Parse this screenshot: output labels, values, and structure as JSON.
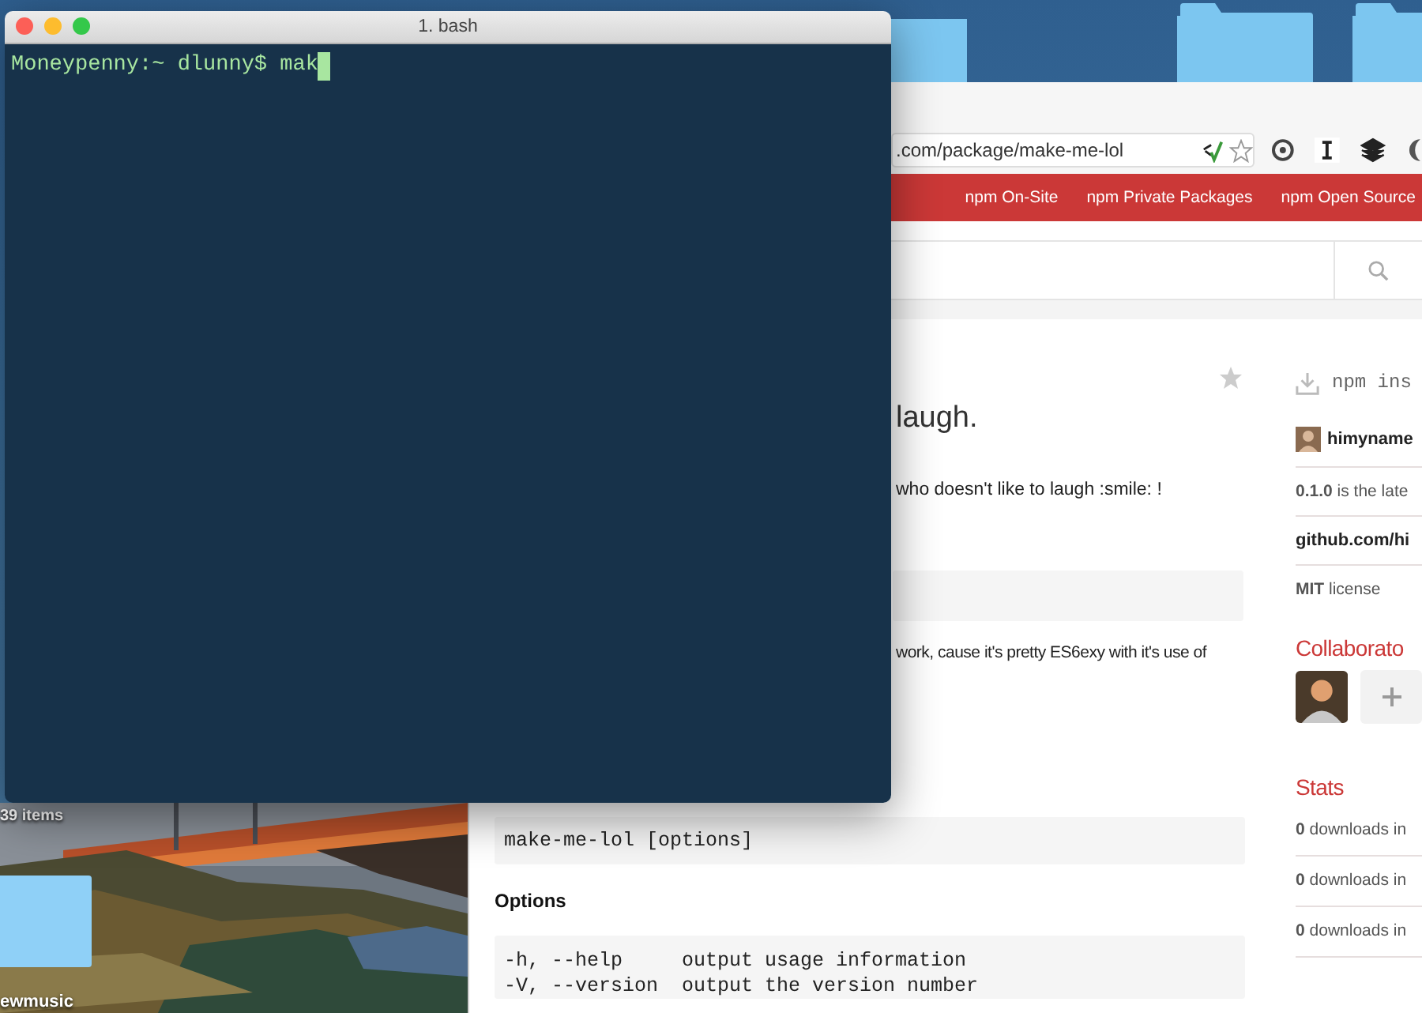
{
  "desktop": {
    "labels": [
      {
        "kind": "count",
        "text": "39 items"
      },
      {
        "kind": "name",
        "text": "ewmusic"
      }
    ]
  },
  "terminal": {
    "title": "1. bash",
    "line": "Moneypenny:~ dlunny$ mak"
  },
  "browser": {
    "url": ".com/package/make-me-lol",
    "nav_links": [
      "npm On-Site",
      "npm Private Packages",
      "npm Open Source"
    ],
    "main": {
      "heading": "laugh.",
      "paragraphs": [
        "who doesn't like to laugh :smile: !",
        "work, cause it's pretty ES6exy with it's use of"
      ],
      "usage": [
        "make-me-lol [options]"
      ],
      "options_heading": "Options",
      "options": [
        "-h, --help     output usage information",
        "-V, --version  output the version number"
      ]
    },
    "sidebar": {
      "install": "npm ins",
      "maintainer": "himyname",
      "version": "**0.1.0** is the late",
      "repository": "github.com/hi",
      "license": "**MIT** license",
      "collaborators_heading": "Collaborato",
      "stats_heading": "Stats",
      "stats": [
        "**0** downloads in",
        "**0** downloads in",
        "**0** downloads in"
      ]
    }
  }
}
